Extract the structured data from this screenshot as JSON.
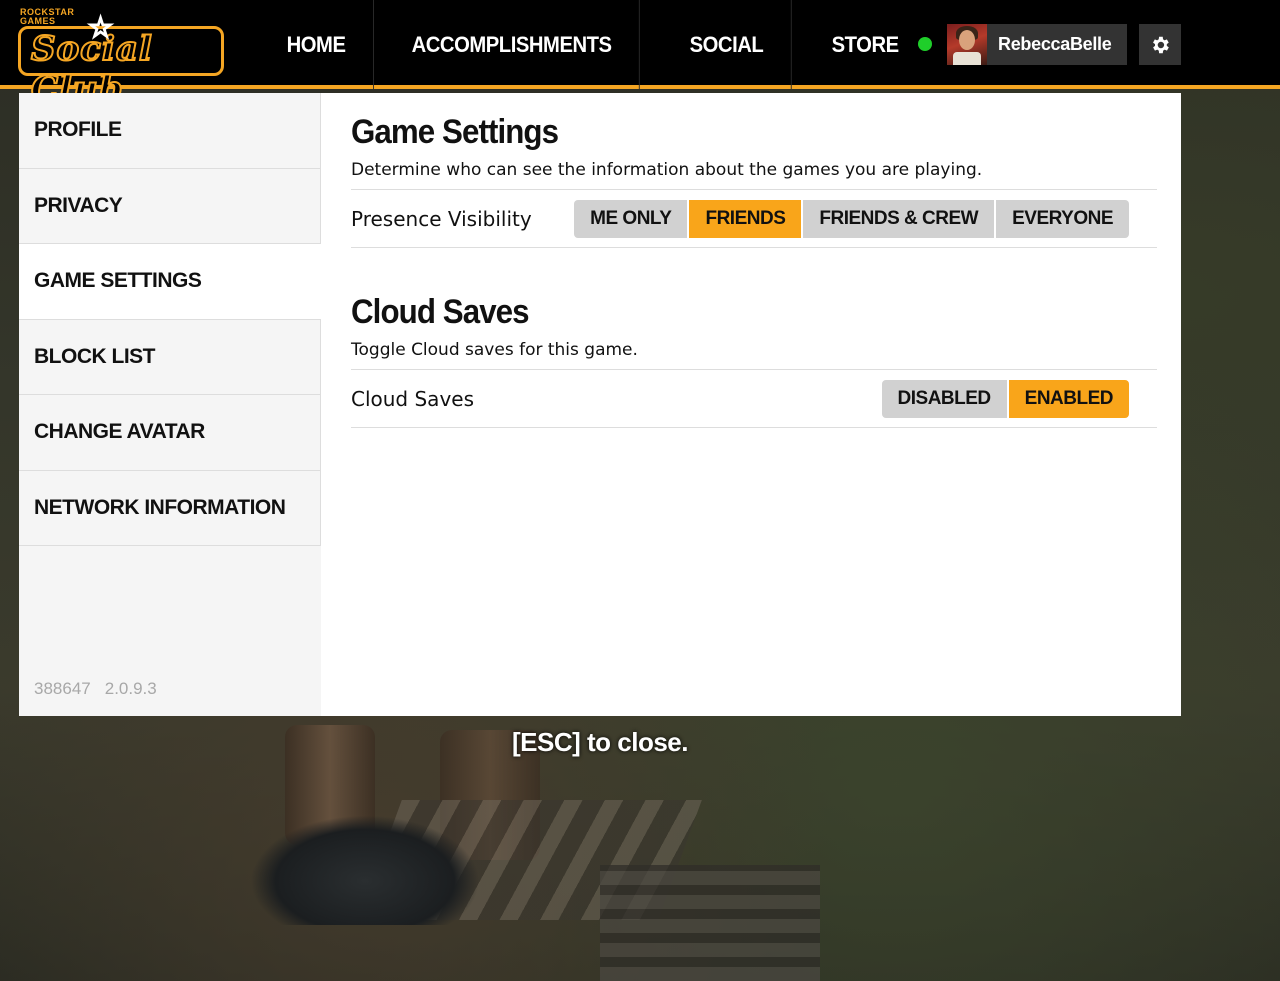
{
  "logo": {
    "small_text": "ROCKSTAR\nGAMES",
    "main_text": "Social Club"
  },
  "nav": {
    "items": [
      {
        "label": "HOME"
      },
      {
        "label": "ACCOMPLISHMENTS"
      },
      {
        "label": "SOCIAL"
      },
      {
        "label": "STORE"
      }
    ]
  },
  "user": {
    "name": "RebeccaBelle",
    "status": "online",
    "status_color": "#1fce2a"
  },
  "sidebar": {
    "items": [
      {
        "label": "PROFILE"
      },
      {
        "label": "PRIVACY"
      },
      {
        "label": "GAME SETTINGS"
      },
      {
        "label": "BLOCK LIST"
      },
      {
        "label": "CHANGE AVATAR"
      },
      {
        "label": "NETWORK INFORMATION"
      }
    ],
    "active": "GAME SETTINGS",
    "version_id": "388647",
    "version": "2.0.9.3"
  },
  "game_settings": {
    "title": "Game Settings",
    "description": "Determine who can see the information about the games you are playing.",
    "presence_label": "Presence Visibility",
    "presence_options": [
      "ME ONLY",
      "FRIENDS",
      "FRIENDS & CREW",
      "EVERYONE"
    ],
    "presence_selected": "FRIENDS"
  },
  "cloud_saves": {
    "title": "Cloud Saves",
    "description": "Toggle Cloud saves for this game.",
    "label": "Cloud Saves",
    "options": [
      "DISABLED",
      "ENABLED"
    ],
    "selected": "ENABLED"
  },
  "esc_hint": "[ESC] to close.",
  "colors": {
    "accent": "#f5a623",
    "selected": "#f9a51a",
    "button_bg": "#d1d1d1"
  }
}
